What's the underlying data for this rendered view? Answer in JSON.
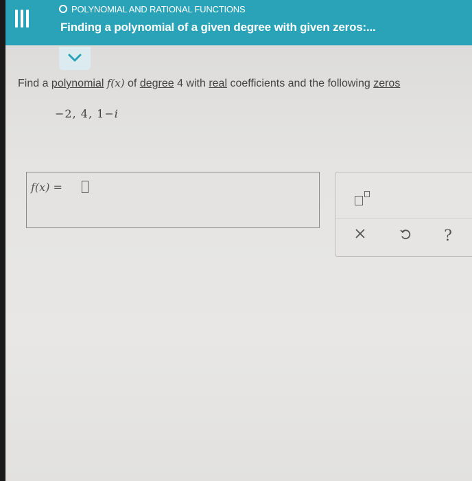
{
  "header": {
    "topic": "POLYNOMIAL AND RATIONAL FUNCTIONS",
    "title": "Finding a polynomial of a given degree with given zeros:..."
  },
  "question": {
    "prefix": "Find a ",
    "polynomial_link": "polynomial",
    "function_name": "f(x)",
    "of_text": " of ",
    "degree_link": "degree",
    "middle": " 4 with ",
    "real_link": "real",
    "coefficients_text": " coefficients and the following ",
    "zeros_link": "zeros"
  },
  "zeros": {
    "zero_1": "−2",
    "sep_1": ",",
    "zero_2": "4",
    "sep_2": ",",
    "zero_3": "1−",
    "zero_3_imag": "i"
  },
  "answer": {
    "label": "f(x) ="
  },
  "tools": {
    "clear_symbol": "×",
    "help_symbol": "?"
  },
  "icons": {
    "menu": "menu-icon",
    "topic": "circle-icon",
    "collapse": "chevron-down-icon",
    "exponent": "exponent-template-icon",
    "clear": "close-icon",
    "undo": "undo-icon",
    "help": "question-mark-icon"
  },
  "colors": {
    "header_bg": "#2aa3b8",
    "header_text": "#ffffff",
    "chevron": "#2aa3b8",
    "page_bg": "#e5e4e2"
  }
}
